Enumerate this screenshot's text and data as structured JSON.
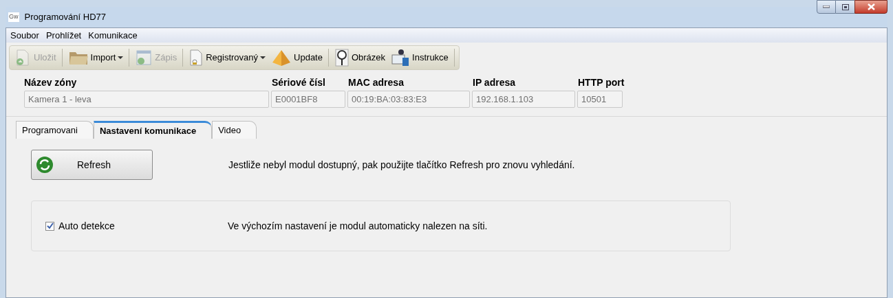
{
  "window": {
    "title": "Programování HD77",
    "app_icon": "Gw"
  },
  "menu": [
    "Soubor",
    "Prohlížet",
    "Komunikace"
  ],
  "toolbar": [
    {
      "kind": "button",
      "label": "Uložit",
      "disabled": true,
      "dropdown": false
    },
    {
      "kind": "separator"
    },
    {
      "kind": "button",
      "label": "Import",
      "disabled": false,
      "dropdown": true
    },
    {
      "kind": "separator"
    },
    {
      "kind": "button",
      "label": "Zápis",
      "disabled": true,
      "dropdown": false
    },
    {
      "kind": "separator"
    },
    {
      "kind": "button",
      "label": "Registrovaný",
      "disabled": false,
      "dropdown": true
    },
    {
      "kind": "button",
      "label": "Update",
      "disabled": false,
      "dropdown": false
    },
    {
      "kind": "separator"
    },
    {
      "kind": "button",
      "label": "Obrázek",
      "disabled": false,
      "dropdown": false
    },
    {
      "kind": "button",
      "label": "Instrukce",
      "disabled": false,
      "dropdown": false
    },
    {
      "kind": "separator"
    }
  ],
  "fields": [
    {
      "label": "Název zóny",
      "value": "Kamera 1 - leva"
    },
    {
      "label": "Sériové čísl",
      "value": "E0001BF8"
    },
    {
      "label": "MAC adresa",
      "value": "00:19:BA:03:83:E3"
    },
    {
      "label": "IP adresa",
      "value": "192.168.1.103"
    },
    {
      "label": "HTTP port",
      "value": "10501"
    }
  ],
  "tabs": [
    {
      "label": "Programovani",
      "selected": false
    },
    {
      "label": "Nastavení komunikace",
      "selected": true
    },
    {
      "label": "Video",
      "selected": false
    }
  ],
  "refresh": {
    "label": "Refresh",
    "hint": "Jestliže nebyl modul dostupný, pak použijte tlačítko Refresh pro znovu vyhledání."
  },
  "auto_detect": {
    "label": "Auto detekce",
    "checked": true,
    "hint": "Ve výchozím nastavení je modul automaticky nalezen na síti."
  }
}
